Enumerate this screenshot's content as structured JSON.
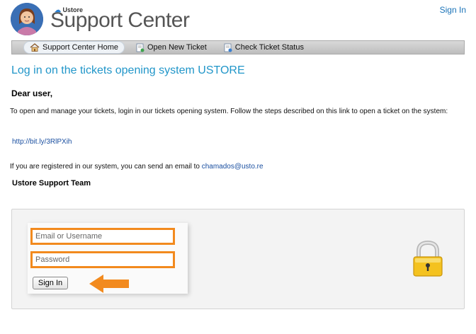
{
  "header": {
    "brand_small": "Ustore",
    "title": "Support Center",
    "signin_link": "Sign In"
  },
  "nav": {
    "items": [
      {
        "label": "Support Center Home",
        "icon": "home-icon",
        "active": true
      },
      {
        "label": "Open New Ticket",
        "icon": "new-ticket-icon",
        "active": false
      },
      {
        "label": "Check Ticket Status",
        "icon": "ticket-status-icon",
        "active": false
      }
    ]
  },
  "main": {
    "title": "Log in on the tickets opening system USTORE",
    "greeting": "Dear user,",
    "paragraph": "To open and manage your tickets, login in our tickets opening system. Follow the steps described on this link to open a ticket on the system:",
    "link": "http://bit.ly/3RlPXih",
    "email_text": "If you are registered in our system, you can send an email to ",
    "email": "chamados@usto.re",
    "signature": "Ustore Support Team"
  },
  "login": {
    "email_placeholder": "Email or Username",
    "password_placeholder": "Password",
    "submit_label": "Sign In"
  },
  "colors": {
    "accent": "#2196c9",
    "highlight": "#f28a1e",
    "link": "#1a4fa0"
  }
}
